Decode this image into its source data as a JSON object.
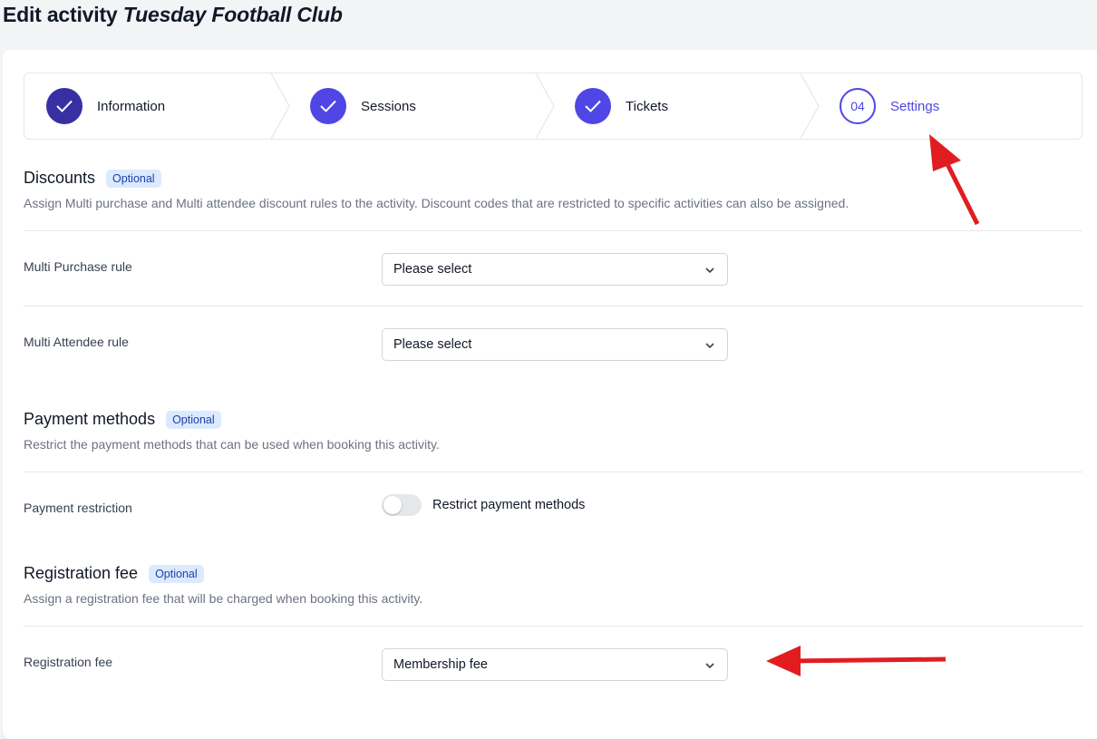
{
  "header": {
    "title_prefix": "Edit activity",
    "title_name": "Tuesday Football Club"
  },
  "stepper": {
    "steps": [
      {
        "label": "Information",
        "state": "complete"
      },
      {
        "label": "Sessions",
        "state": "complete"
      },
      {
        "label": "Tickets",
        "state": "complete"
      },
      {
        "label": "Settings",
        "number": "04",
        "state": "current"
      }
    ]
  },
  "discounts": {
    "title": "Discounts",
    "badge": "Optional",
    "description": "Assign Multi purchase and Multi attendee discount rules to the activity. Discount codes that are restricted to specific activities can also be assigned.",
    "fields": [
      {
        "label": "Multi Purchase rule",
        "value": "Please select"
      },
      {
        "label": "Multi Attendee rule",
        "value": "Please select"
      }
    ]
  },
  "payment": {
    "title": "Payment methods",
    "badge": "Optional",
    "description": "Restrict the payment methods that can be used when booking this activity.",
    "field_label": "Payment restriction",
    "toggle_label": "Restrict payment methods",
    "toggle_on": false
  },
  "registration": {
    "title": "Registration fee",
    "badge": "Optional",
    "description": "Assign a registration fee that will be charged when booking this activity.",
    "field_label": "Registration fee",
    "value": "Membership fee"
  },
  "colors": {
    "accent": "#4f46e5",
    "annotation": "#e11d22",
    "badge_bg": "#dbeafe"
  }
}
